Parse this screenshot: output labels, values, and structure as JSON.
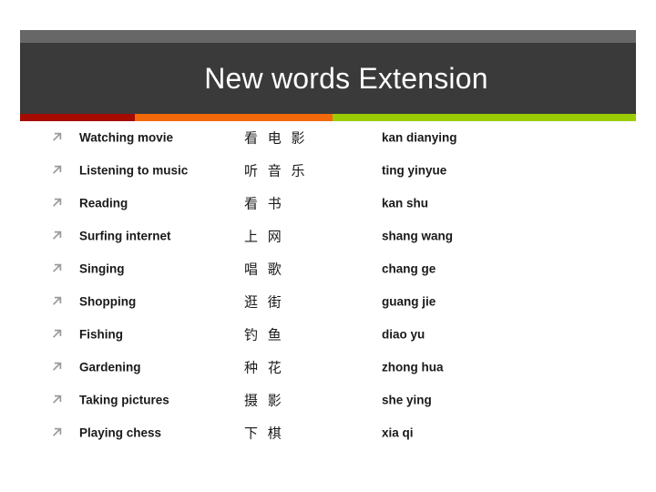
{
  "slide": {
    "title": "New words Extension",
    "accent_colors": {
      "red": "#A50B00",
      "orange": "#F4690B",
      "green": "#9ACD06",
      "header_top": "#676767",
      "header_band": "#3a3a3a",
      "title_text": "#ffffff",
      "bullet": "#9a9a9a",
      "body_text": "#1a1a1a"
    },
    "bullet_icon": "arrow-up-right-icon"
  },
  "vocab": {
    "rows": [
      {
        "english": "Watching movie",
        "chinese": "看 电 影",
        "pinyin": "kan dianying"
      },
      {
        "english": "Listening to music",
        "chinese": "听 音 乐",
        "pinyin": "ting yinyue"
      },
      {
        "english": "Reading",
        "chinese": "看 书",
        "pinyin": "kan shu"
      },
      {
        "english": "Surfing internet",
        "chinese": "上 网",
        "pinyin": "shang wang"
      },
      {
        "english": "Singing",
        "chinese": "唱 歌",
        "pinyin": "chang ge"
      },
      {
        "english": "Shopping",
        "chinese": "逛 街",
        "pinyin": "guang jie"
      },
      {
        "english": "Fishing",
        "chinese": "钓 鱼",
        "pinyin": "diao yu"
      },
      {
        "english": "Gardening",
        "chinese": "种 花",
        "pinyin": "zhong hua"
      },
      {
        "english": "Taking pictures",
        "chinese": "摄 影",
        "pinyin": "she ying"
      },
      {
        "english": "Playing chess",
        "chinese": "下 棋",
        "pinyin": "xia qi"
      }
    ]
  }
}
